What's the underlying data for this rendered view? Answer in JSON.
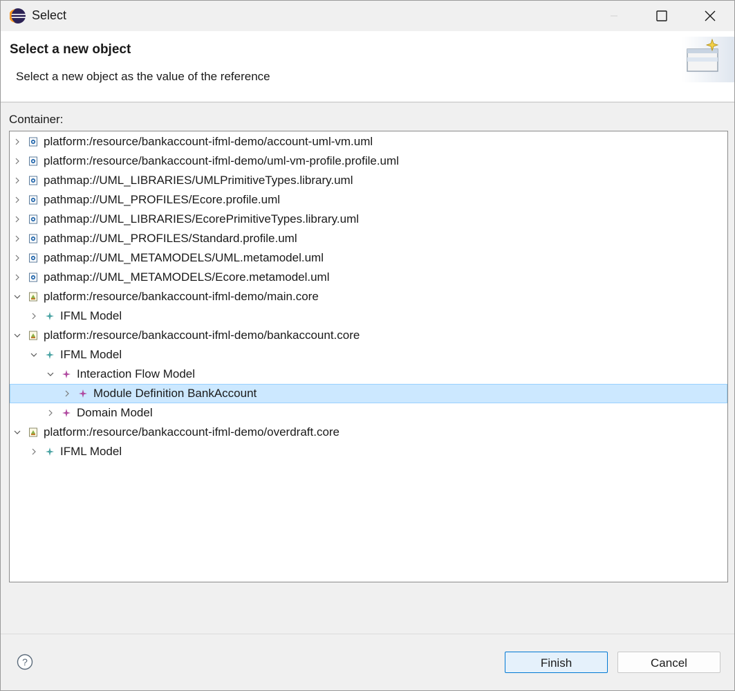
{
  "window": {
    "title": "Select",
    "controls": [
      "minimize",
      "maximize",
      "close"
    ]
  },
  "header": {
    "title": "Select a new object",
    "description": "Select a new object as the value of the reference"
  },
  "container_label": "Container:",
  "tree": [
    {
      "label": "platform:/resource/bankaccount-ifml-demo/account-uml-vm.uml",
      "icon": "uml-file-icon",
      "expanded": false
    },
    {
      "label": "platform:/resource/bankaccount-ifml-demo/uml-vm-profile.profile.uml",
      "icon": "uml-file-icon",
      "expanded": false
    },
    {
      "label": "pathmap://UML_LIBRARIES/UMLPrimitiveTypes.library.uml",
      "icon": "uml-file-icon",
      "expanded": false
    },
    {
      "label": "pathmap://UML_PROFILES/Ecore.profile.uml",
      "icon": "uml-file-icon",
      "expanded": false
    },
    {
      "label": "pathmap://UML_LIBRARIES/EcorePrimitiveTypes.library.uml",
      "icon": "uml-file-icon",
      "expanded": false
    },
    {
      "label": "pathmap://UML_PROFILES/Standard.profile.uml",
      "icon": "uml-file-icon",
      "expanded": false
    },
    {
      "label": "pathmap://UML_METAMODELS/UML.metamodel.uml",
      "icon": "uml-file-icon",
      "expanded": false
    },
    {
      "label": "pathmap://UML_METAMODELS/Ecore.metamodel.uml",
      "icon": "uml-file-icon",
      "expanded": false
    },
    {
      "label": "platform:/resource/bankaccount-ifml-demo/main.core",
      "icon": "core-file-icon",
      "expanded": true
    },
    {
      "label": "IFML Model",
      "icon": "ifml-model-icon",
      "expanded": false
    },
    {
      "label": "platform:/resource/bankaccount-ifml-demo/bankaccount.core",
      "icon": "core-file-icon",
      "expanded": true
    },
    {
      "label": "IFML Model",
      "icon": "ifml-model-icon",
      "expanded": true
    },
    {
      "label": "Interaction Flow Model",
      "icon": "model-element-icon",
      "expanded": true
    },
    {
      "label": "Module Definition BankAccount",
      "icon": "model-element-icon",
      "expanded": false,
      "selected": true
    },
    {
      "label": "Domain Model",
      "icon": "model-element-icon",
      "expanded": false
    },
    {
      "label": "platform:/resource/bankaccount-ifml-demo/overdraft.core",
      "icon": "core-file-icon",
      "expanded": true
    },
    {
      "label": "IFML Model",
      "icon": "ifml-model-icon",
      "expanded": false
    }
  ],
  "buttons": {
    "finish": "Finish",
    "cancel": "Cancel",
    "help_icon": "help-icon"
  },
  "colors": {
    "selection": "#cce8ff",
    "default_button_border": "#0078d4",
    "ifml_icon": "#4aa3a3",
    "element_icon": "#b04aa0"
  }
}
